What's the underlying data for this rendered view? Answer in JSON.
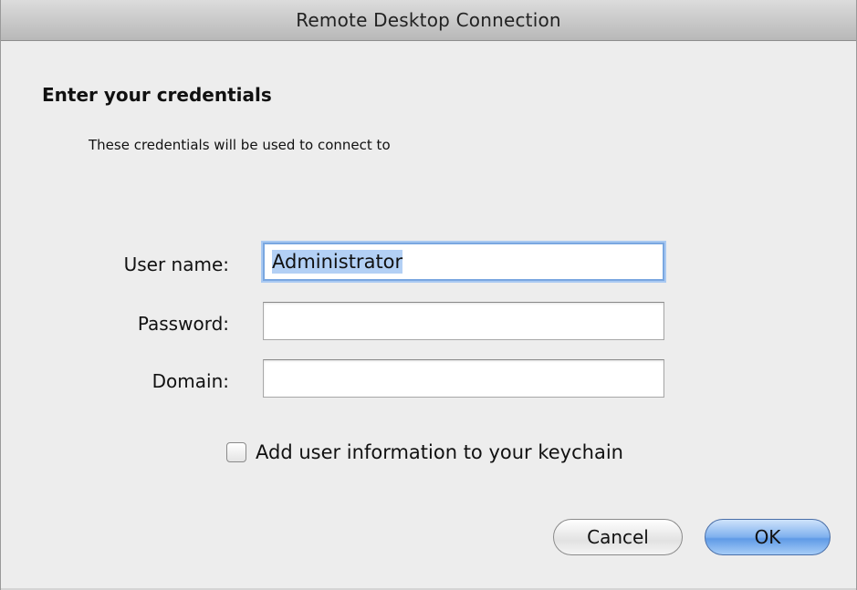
{
  "window": {
    "title": "Remote Desktop Connection"
  },
  "dialog": {
    "heading": "Enter your credentials",
    "subtext": "These credentials will be used to connect to"
  },
  "form": {
    "username_label": "User name:",
    "username_value": "Administrator",
    "password_label": "Password:",
    "password_value": "",
    "domain_label": "Domain:",
    "domain_value": ""
  },
  "options": {
    "keychain_label": "Add user information to your keychain",
    "keychain_checked": false
  },
  "buttons": {
    "cancel_label": "Cancel",
    "ok_label": "OK"
  },
  "colors": {
    "focus_ring": "#7aa7e0",
    "selection": "#b3d0f5",
    "default_button": "#5f9ae6"
  }
}
